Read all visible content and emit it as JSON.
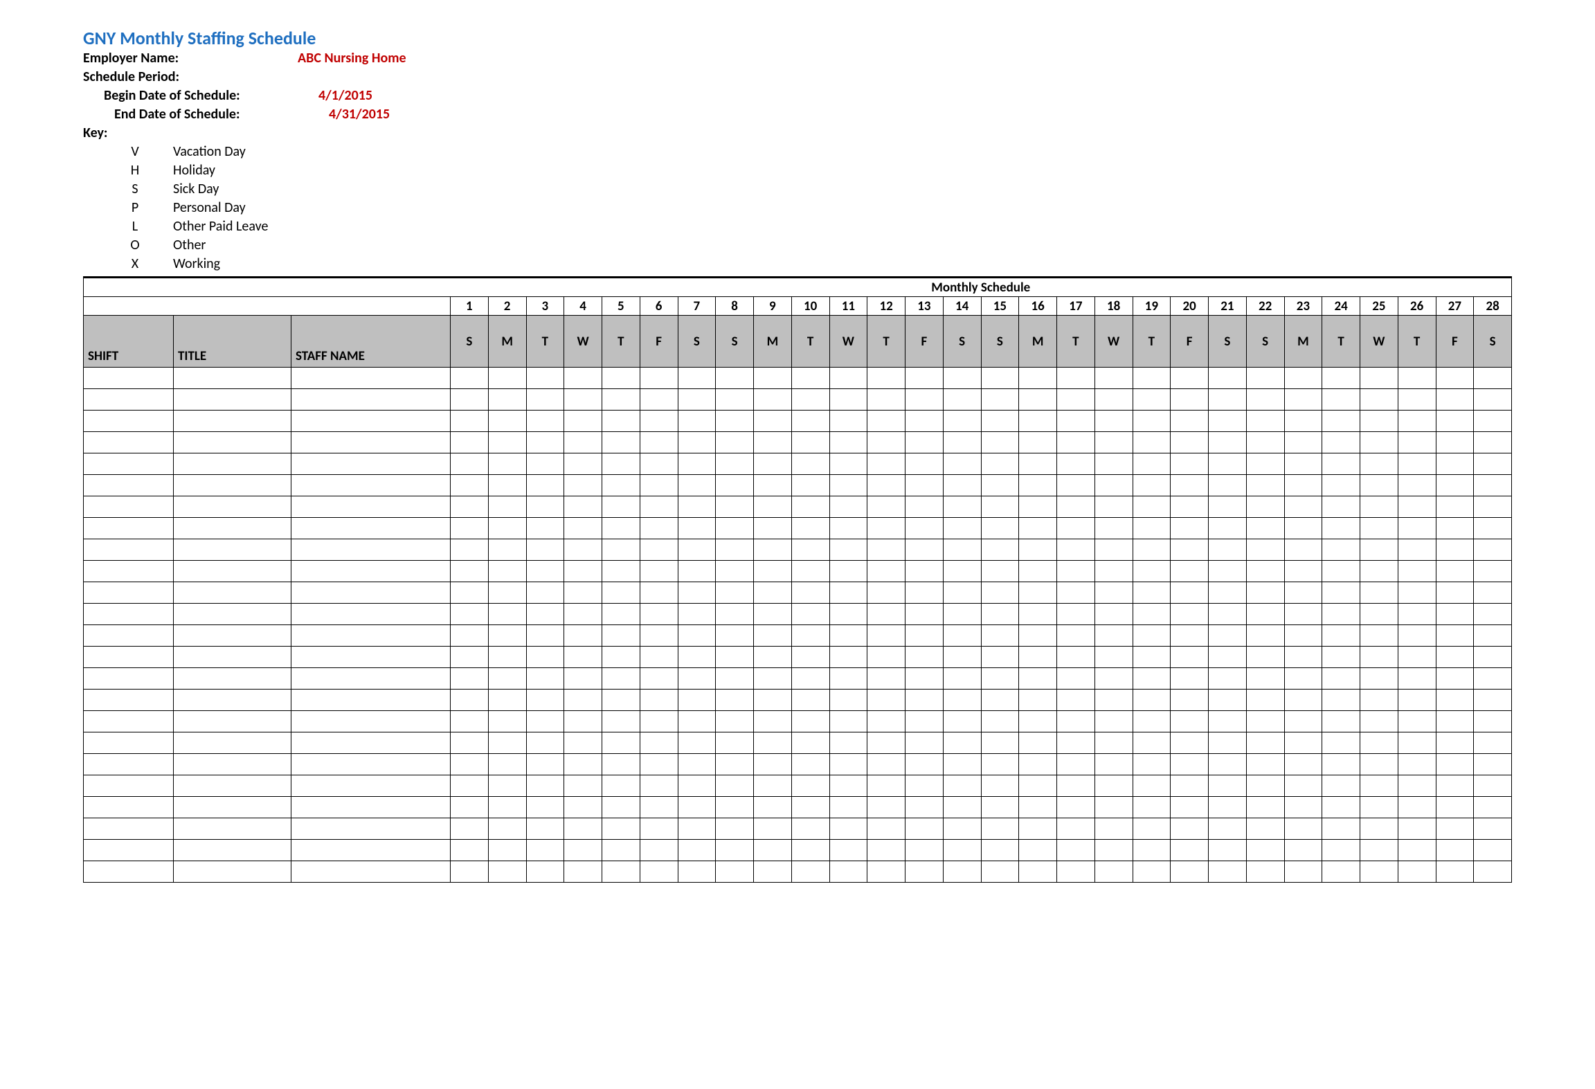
{
  "title": "GNY Monthly Staffing Schedule",
  "header": {
    "employer_label": "Employer Name:",
    "employer_value": "ABC Nursing Home",
    "period_label": "Schedule Period:",
    "begin_label": "Begin Date of Schedule:",
    "begin_value": "4/1/2015",
    "end_label": "End Date of Schedule:",
    "end_value": "4/31/2015"
  },
  "key": {
    "label": "Key:",
    "items": [
      {
        "code": "V",
        "desc": "Vacation Day"
      },
      {
        "code": "H",
        "desc": "Holiday"
      },
      {
        "code": "S",
        "desc": "Sick Day"
      },
      {
        "code": "P",
        "desc": "Personal Day"
      },
      {
        "code": "L",
        "desc": "Other Paid Leave"
      },
      {
        "code": "O",
        "desc": "Other"
      },
      {
        "code": "X",
        "desc": "Working"
      }
    ]
  },
  "table": {
    "monthly_schedule_label": "Monthly Schedule",
    "columns": {
      "shift": "SHIFT",
      "title": "TITLE",
      "staff_name": "STAFF NAME"
    },
    "days": [
      {
        "n": "1",
        "d": "S"
      },
      {
        "n": "2",
        "d": "M"
      },
      {
        "n": "3",
        "d": "T"
      },
      {
        "n": "4",
        "d": "W"
      },
      {
        "n": "5",
        "d": "T"
      },
      {
        "n": "6",
        "d": "F"
      },
      {
        "n": "7",
        "d": "S"
      },
      {
        "n": "8",
        "d": "S"
      },
      {
        "n": "9",
        "d": "M"
      },
      {
        "n": "10",
        "d": "T"
      },
      {
        "n": "11",
        "d": "W"
      },
      {
        "n": "12",
        "d": "T"
      },
      {
        "n": "13",
        "d": "F"
      },
      {
        "n": "14",
        "d": "S"
      },
      {
        "n": "15",
        "d": "S"
      },
      {
        "n": "16",
        "d": "M"
      },
      {
        "n": "17",
        "d": "T"
      },
      {
        "n": "18",
        "d": "W"
      },
      {
        "n": "19",
        "d": "T"
      },
      {
        "n": "20",
        "d": "F"
      },
      {
        "n": "21",
        "d": "S"
      },
      {
        "n": "22",
        "d": "S"
      },
      {
        "n": "23",
        "d": "M"
      },
      {
        "n": "24",
        "d": "T"
      },
      {
        "n": "25",
        "d": "W"
      },
      {
        "n": "26",
        "d": "T"
      },
      {
        "n": "27",
        "d": "F"
      },
      {
        "n": "28",
        "d": "S"
      }
    ],
    "body_row_count": 24
  }
}
